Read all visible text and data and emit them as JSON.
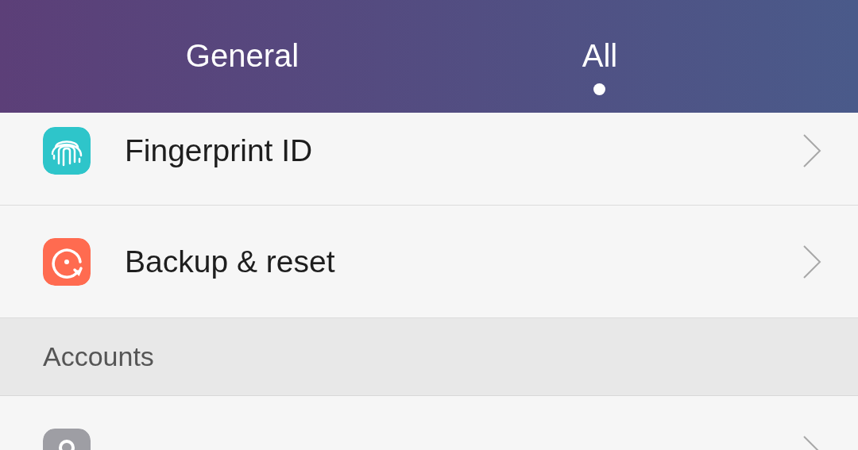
{
  "tabs": [
    {
      "label": "General",
      "selected": false
    },
    {
      "label": "All",
      "selected": true
    }
  ],
  "items": [
    {
      "kind": "fingerprint",
      "color": "#2ec5ca",
      "label": "Fingerprint ID"
    },
    {
      "kind": "backup",
      "color": "#ff6b50",
      "label": "Backup & reset"
    },
    {
      "kind": "header",
      "label": "Accounts"
    },
    {
      "kind": "account",
      "color": "#9e9ea4"
    }
  ]
}
